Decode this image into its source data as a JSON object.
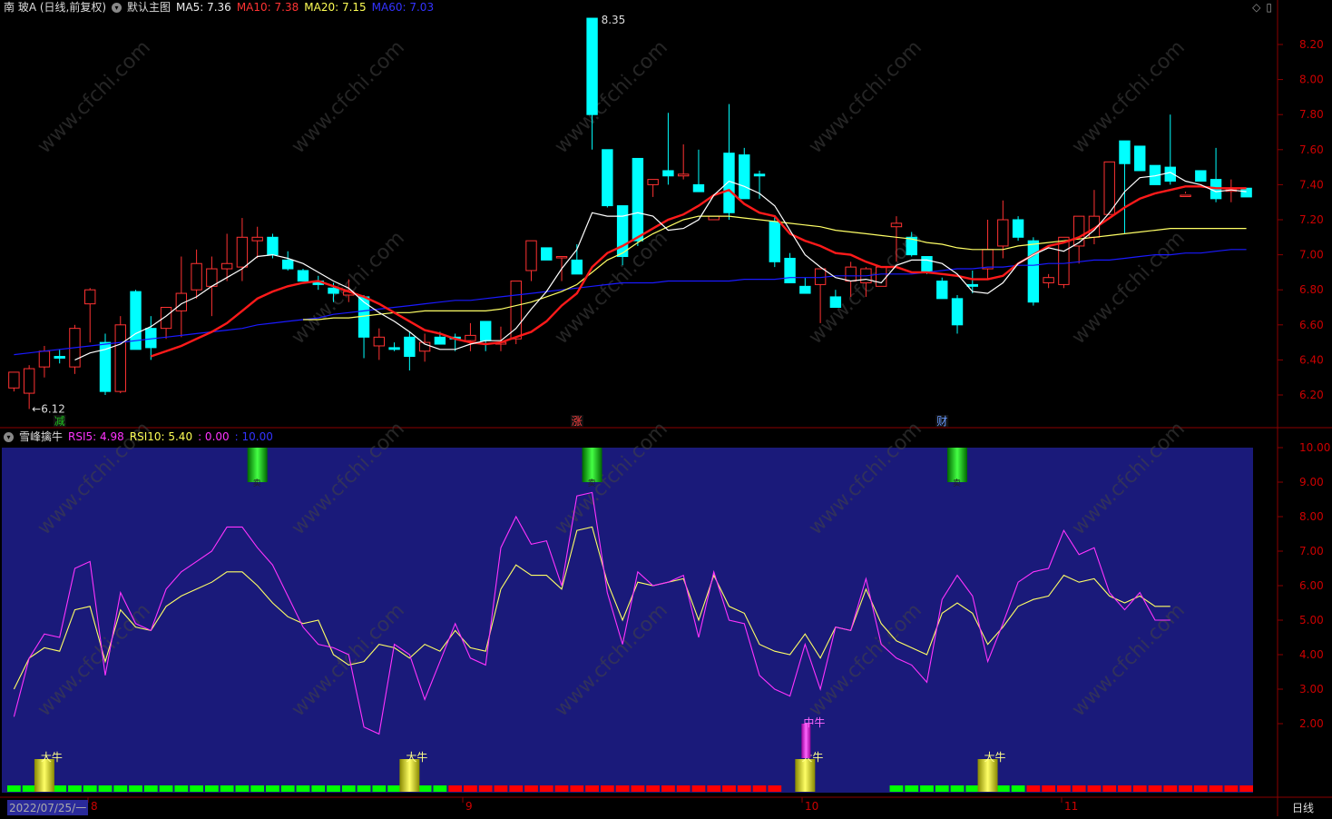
{
  "main": {
    "title": "南 玻A (日线,前复权)",
    "template": "默认主图",
    "ma5": "MA5: 7.36",
    "ma10": "MA10: 7.38",
    "ma20": "MA20: 7.15",
    "ma60": "MA60: 7.03",
    "high_label": "8.35",
    "low_label": "←6.12",
    "markers": [
      "减",
      "涨",
      "财"
    ],
    "yticks": [
      "8.20",
      "8.00",
      "7.80",
      "7.60",
      "7.40",
      "7.20",
      "7.00",
      "6.80",
      "6.60",
      "6.40",
      "6.20"
    ]
  },
  "sub": {
    "title": "雪峰擒牛",
    "rsi5": "RSI5: 4.98",
    "rsi10": "RSI10: 5.40",
    "v1": ": 0.00",
    "v2": ": 10.00",
    "yticks": [
      "10.00",
      "9.00",
      "8.00",
      "7.00",
      "6.00",
      "5.00",
      "4.00",
      "3.00",
      "2.00"
    ],
    "sell_label": "卖",
    "bull_big": "大牛",
    "bull_mid": "中牛"
  },
  "axis": {
    "date": "2022/07/25/一",
    "months": [
      "8",
      "9",
      "10",
      "11"
    ],
    "period": "日线"
  },
  "watermark": "www.cfchi.com",
  "colors": {
    "up": "#ff3232",
    "down": "#00ffff",
    "ma5": "#ffffff",
    "ma10": "#ff1a1a",
    "ma20": "#ffff66",
    "ma60": "#1a1aff",
    "rsi5": "#ff33ff",
    "rsi10": "#ffff66",
    "panel": "#1a1a7a",
    "frame": "#8b0000"
  },
  "chart_data": {
    "type": "candlestick",
    "candles": [
      [
        6.24,
        6.33,
        6.22,
        6.33
      ],
      [
        6.21,
        6.37,
        6.12,
        6.35
      ],
      [
        6.36,
        6.48,
        6.3,
        6.45
      ],
      [
        6.42,
        6.46,
        6.38,
        6.41
      ],
      [
        6.36,
        6.6,
        6.32,
        6.58
      ],
      [
        6.72,
        6.81,
        6.5,
        6.8
      ],
      [
        6.5,
        6.55,
        6.2,
        6.22
      ],
      [
        6.22,
        6.65,
        6.21,
        6.6
      ],
      [
        6.79,
        6.8,
        6.46,
        6.46
      ],
      [
        6.58,
        6.65,
        6.4,
        6.47
      ],
      [
        6.58,
        6.7,
        6.52,
        6.7
      ],
      [
        6.68,
        6.99,
        6.53,
        6.78
      ],
      [
        6.8,
        7.03,
        6.75,
        6.95
      ],
      [
        6.82,
        6.99,
        6.65,
        6.92
      ],
      [
        6.92,
        7.12,
        6.85,
        6.95
      ],
      [
        6.93,
        7.21,
        6.85,
        7.1
      ],
      [
        7.08,
        7.16,
        6.98,
        7.1
      ],
      [
        7.1,
        7.12,
        6.98,
        7.0
      ],
      [
        6.97,
        7.02,
        6.91,
        6.92
      ],
      [
        6.91,
        6.92,
        6.85,
        6.85
      ],
      [
        6.85,
        6.88,
        6.8,
        6.83
      ],
      [
        6.81,
        6.84,
        6.73,
        6.78
      ],
      [
        6.77,
        6.86,
        6.73,
        6.79
      ],
      [
        6.76,
        6.77,
        6.41,
        6.53
      ],
      [
        6.48,
        6.58,
        6.4,
        6.53
      ],
      [
        6.47,
        6.5,
        6.45,
        6.46
      ],
      [
        6.53,
        6.56,
        6.34,
        6.42
      ],
      [
        6.45,
        6.55,
        6.39,
        6.5
      ],
      [
        6.53,
        6.56,
        6.49,
        6.49
      ],
      [
        6.53,
        6.55,
        6.45,
        6.52
      ],
      [
        6.51,
        6.61,
        6.45,
        6.54
      ],
      [
        6.62,
        6.62,
        6.45,
        6.51
      ],
      [
        6.49,
        6.59,
        6.45,
        6.5
      ],
      [
        6.52,
        6.85,
        6.49,
        6.85
      ],
      [
        6.91,
        7.08,
        6.85,
        7.08
      ],
      [
        7.04,
        7.04,
        6.99,
        6.97
      ],
      [
        6.99,
        6.99,
        6.85,
        6.99
      ],
      [
        6.97,
        7.06,
        6.95,
        6.89
      ],
      [
        8.35,
        8.35,
        7.6,
        7.8
      ],
      [
        7.6,
        7.6,
        7.27,
        7.28
      ],
      [
        7.28,
        7.28,
        6.94,
        6.99
      ],
      [
        7.55,
        7.55,
        7.05,
        7.08
      ],
      [
        7.4,
        7.42,
        7.33,
        7.43
      ],
      [
        7.48,
        7.81,
        7.4,
        7.45
      ],
      [
        7.45,
        7.63,
        7.43,
        7.46
      ],
      [
        7.4,
        7.6,
        7.37,
        7.36
      ],
      [
        7.2,
        7.2,
        7.22,
        7.22
      ],
      [
        7.58,
        7.86,
        7.2,
        7.24
      ],
      [
        7.57,
        7.61,
        7.32,
        7.32
      ],
      [
        7.46,
        7.48,
        7.32,
        7.45
      ],
      [
        7.19,
        7.22,
        6.93,
        6.96
      ],
      [
        6.98,
        7.01,
        6.84,
        6.84
      ],
      [
        6.82,
        6.87,
        6.8,
        6.78
      ],
      [
        6.83,
        6.92,
        6.61,
        6.92
      ],
      [
        6.76,
        6.8,
        6.7,
        6.7
      ],
      [
        6.85,
        6.96,
        6.76,
        6.93
      ],
      [
        6.84,
        6.93,
        6.76,
        6.92
      ],
      [
        6.82,
        6.9,
        6.82,
        6.93
      ],
      [
        7.16,
        7.22,
        6.96,
        7.18
      ],
      [
        7.1,
        7.13,
        6.99,
        7.0
      ],
      [
        6.99,
        6.99,
        6.89,
        6.9
      ],
      [
        6.85,
        6.87,
        6.75,
        6.75
      ],
      [
        6.75,
        6.77,
        6.55,
        6.6
      ],
      [
        6.83,
        6.91,
        6.78,
        6.82
      ],
      [
        6.92,
        7.2,
        6.86,
        7.03
      ],
      [
        7.05,
        7.31,
        6.98,
        7.2
      ],
      [
        7.2,
        7.22,
        7.08,
        7.1
      ],
      [
        7.08,
        7.1,
        6.71,
        6.73
      ],
      [
        6.84,
        6.89,
        6.81,
        6.87
      ],
      [
        6.83,
        6.99,
        6.81,
        7.1
      ],
      [
        7.05,
        7.22,
        6.95,
        7.22
      ],
      [
        7.1,
        7.37,
        7.06,
        7.22
      ],
      [
        7.23,
        7.37,
        7.24,
        7.53
      ],
      [
        7.65,
        7.65,
        7.12,
        7.52
      ],
      [
        7.62,
        7.62,
        7.6,
        7.48
      ],
      [
        7.51,
        7.51,
        7.4,
        7.4
      ],
      [
        7.5,
        7.8,
        7.4,
        7.42
      ],
      [
        7.34,
        7.35,
        7.36,
        7.34
      ],
      [
        7.48,
        7.48,
        7.44,
        7.42
      ],
      [
        7.43,
        7.61,
        7.3,
        7.32
      ],
      [
        7.37,
        7.43,
        7.3,
        7.37
      ],
      [
        7.38,
        7.38,
        7.33,
        7.33
      ]
    ],
    "ma5": [
      null,
      null,
      null,
      null,
      6.4,
      6.44,
      6.46,
      6.49,
      6.55,
      6.59,
      6.65,
      6.72,
      6.76,
      6.82,
      6.87,
      6.92,
      6.99,
      7.0,
      6.98,
      6.95,
      6.9,
      6.85,
      6.81,
      6.73,
      6.67,
      6.62,
      6.56,
      6.49,
      6.46,
      6.46,
      6.49,
      6.51,
      6.51,
      6.58,
      6.69,
      6.79,
      6.92,
      7.03,
      7.24,
      7.22,
      7.22,
      7.24,
      7.22,
      7.14,
      7.15,
      7.2,
      7.34,
      7.42,
      7.39,
      7.35,
      7.28,
      7.14,
      7.0,
      6.93,
      6.87,
      6.85,
      6.86,
      6.84,
      6.94,
      6.97,
      6.97,
      6.95,
      6.89,
      6.79,
      6.78,
      6.84,
      6.95,
      7.0,
      7.04,
      7.02,
      7.07,
      7.14,
      7.24,
      7.36,
      7.44,
      7.45,
      7.47,
      7.42,
      7.4,
      7.36,
      7.37,
      7.36
    ],
    "ma10": [
      null,
      null,
      null,
      null,
      null,
      null,
      null,
      null,
      null,
      6.42,
      6.45,
      6.48,
      6.52,
      6.56,
      6.61,
      6.68,
      6.75,
      6.79,
      6.82,
      6.84,
      6.85,
      6.82,
      6.79,
      6.76,
      6.72,
      6.67,
      6.62,
      6.57,
      6.55,
      6.52,
      6.5,
      6.49,
      6.5,
      6.53,
      6.56,
      6.62,
      6.71,
      6.78,
      6.93,
      7.01,
      7.05,
      7.1,
      7.15,
      7.2,
      7.23,
      7.28,
      7.34,
      7.37,
      7.29,
      7.24,
      7.22,
      7.12,
      7.08,
      7.05,
      7.01,
      7.0,
      6.96,
      6.93,
      6.93,
      6.9,
      6.9,
      6.89,
      6.88,
      6.86,
      6.86,
      6.88,
      6.95,
      7.0,
      7.05,
      7.07,
      7.1,
      7.15,
      7.21,
      7.27,
      7.32,
      7.35,
      7.37,
      7.39,
      7.39,
      7.38,
      7.38,
      7.38
    ],
    "ma20": [
      null,
      null,
      null,
      null,
      null,
      null,
      null,
      null,
      null,
      null,
      null,
      null,
      null,
      null,
      null,
      null,
      null,
      null,
      null,
      6.63,
      6.63,
      6.64,
      6.64,
      6.65,
      6.66,
      6.67,
      6.67,
      6.68,
      6.68,
      6.68,
      6.68,
      6.68,
      6.69,
      6.71,
      6.73,
      6.76,
      6.79,
      6.83,
      6.9,
      6.97,
      7.01,
      7.07,
      7.12,
      7.16,
      7.2,
      7.22,
      7.22,
      7.22,
      7.21,
      7.2,
      7.19,
      7.18,
      7.17,
      7.16,
      7.14,
      7.13,
      7.12,
      7.11,
      7.1,
      7.09,
      7.07,
      7.06,
      7.04,
      7.03,
      7.03,
      7.03,
      7.05,
      7.06,
      7.07,
      7.08,
      7.09,
      7.1,
      7.11,
      7.12,
      7.13,
      7.14,
      7.15,
      7.15,
      7.15,
      7.15,
      7.15,
      7.15
    ],
    "ma60": [
      6.43,
      6.44,
      6.45,
      6.46,
      6.47,
      6.48,
      6.49,
      6.5,
      6.51,
      6.52,
      6.53,
      6.54,
      6.55,
      6.56,
      6.57,
      6.58,
      6.6,
      6.61,
      6.62,
      6.63,
      6.64,
      6.66,
      6.67,
      6.68,
      6.69,
      6.7,
      6.71,
      6.72,
      6.73,
      6.74,
      6.74,
      6.75,
      6.76,
      6.77,
      6.78,
      6.79,
      6.8,
      6.81,
      6.82,
      6.83,
      6.84,
      6.84,
      6.84,
      6.85,
      6.85,
      6.85,
      6.85,
      6.85,
      6.86,
      6.86,
      6.86,
      6.87,
      6.87,
      6.87,
      6.88,
      6.88,
      6.88,
      6.89,
      6.89,
      6.89,
      6.9,
      6.91,
      6.92,
      6.92,
      6.93,
      6.93,
      6.94,
      6.94,
      6.95,
      6.95,
      6.96,
      6.97,
      6.97,
      6.98,
      6.99,
      7.0,
      7.0,
      7.01,
      7.01,
      7.02,
      7.03,
      7.03
    ],
    "rsi5": [
      2.2,
      3.9,
      4.6,
      4.5,
      6.5,
      6.7,
      3.4,
      5.8,
      4.9,
      4.7,
      5.9,
      6.4,
      6.7,
      7.0,
      7.7,
      7.7,
      7.1,
      6.6,
      5.7,
      4.8,
      4.3,
      4.2,
      4.0,
      1.9,
      1.7,
      4.3,
      4.0,
      2.7,
      3.8,
      4.9,
      3.9,
      3.7,
      7.1,
      8.0,
      7.2,
      7.3,
      6.0,
      8.6,
      8.7,
      5.8,
      4.3,
      6.4,
      6.0,
      6.1,
      6.3,
      4.5,
      6.4,
      5.0,
      4.9,
      3.4,
      3.0,
      2.8,
      4.3,
      3.0,
      4.8,
      4.7,
      6.2,
      4.3,
      3.9,
      3.7,
      3.2,
      5.6,
      6.3,
      5.7,
      3.8,
      4.9,
      6.1,
      6.4,
      6.5,
      7.6,
      6.9,
      7.1,
      5.8,
      5.3,
      5.8,
      5.0,
      5.0
    ],
    "rsi10": [
      3.0,
      3.9,
      4.2,
      4.1,
      5.3,
      5.4,
      3.8,
      5.3,
      4.8,
      4.7,
      5.4,
      5.7,
      5.9,
      6.1,
      6.4,
      6.4,
      6.0,
      5.5,
      5.1,
      4.9,
      5.0,
      4.0,
      3.7,
      3.8,
      4.3,
      4.2,
      3.9,
      4.3,
      4.1,
      4.7,
      4.2,
      4.1,
      5.9,
      6.6,
      6.3,
      6.3,
      5.9,
      7.6,
      7.7,
      6.1,
      5.0,
      6.1,
      6.0,
      6.1,
      6.2,
      5.0,
      6.3,
      5.4,
      5.2,
      4.3,
      4.1,
      4.0,
      4.6,
      3.9,
      4.8,
      4.7,
      5.9,
      4.9,
      4.4,
      4.2,
      4.0,
      5.2,
      5.5,
      5.2,
      4.3,
      4.8,
      5.4,
      5.6,
      5.7,
      6.3,
      6.1,
      6.2,
      5.7,
      5.5,
      5.7,
      5.4,
      5.4
    ],
    "signal_bars": "00000111111111111111111111111222222222222222222222200000001111111112222222222222222",
    "sell_positions": [
      16,
      38,
      62
    ],
    "bull_big_positions": [
      2,
      26,
      52,
      64
    ],
    "bull_mid_positions": [
      52
    ]
  }
}
